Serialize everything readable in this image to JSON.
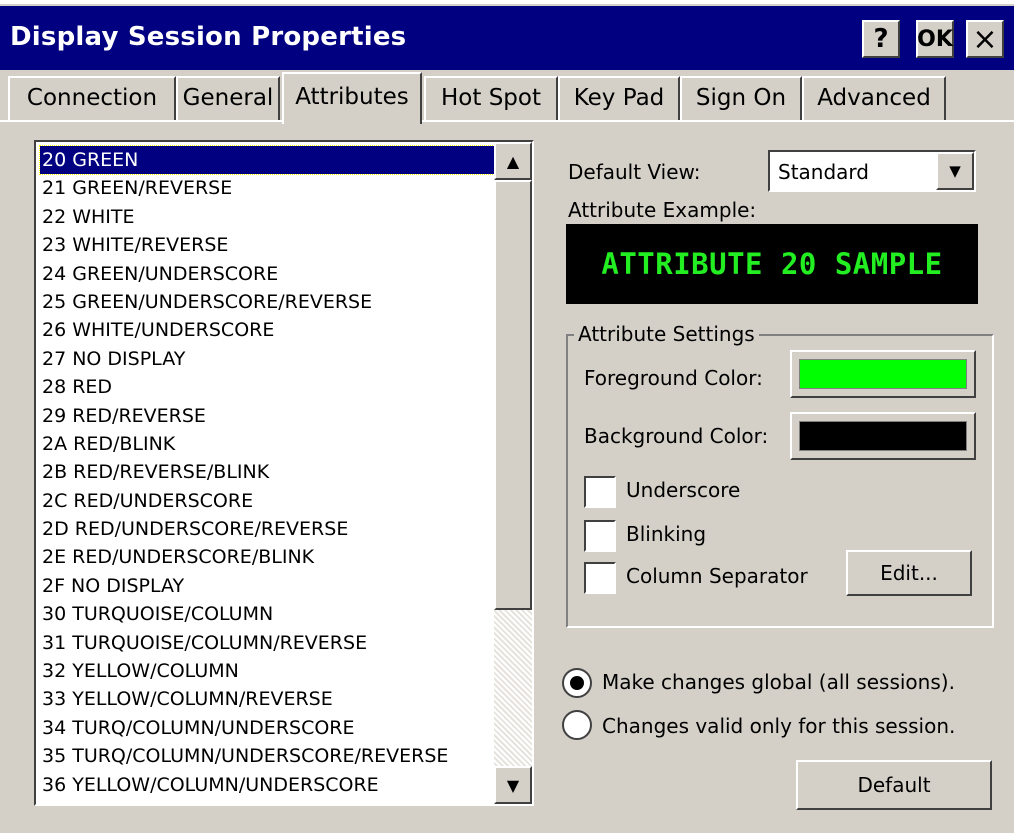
{
  "window": {
    "title": "Display Session Properties",
    "help_label": "?",
    "ok_label": "OK",
    "close_label": "×"
  },
  "tabs": [
    {
      "label": "Connection",
      "active": false
    },
    {
      "label": "General",
      "active": false
    },
    {
      "label": "Attributes",
      "active": true
    },
    {
      "label": "Hot Spot",
      "active": false
    },
    {
      "label": "Key Pad",
      "active": false
    },
    {
      "label": "Sign On",
      "active": false
    },
    {
      "label": "Advanced",
      "active": false
    }
  ],
  "attribute_list": {
    "selected_index": 0,
    "items": [
      "20 GREEN",
      "21 GREEN/REVERSE",
      "22 WHITE",
      "23 WHITE/REVERSE",
      "24 GREEN/UNDERSCORE",
      "25 GREEN/UNDERSCORE/REVERSE",
      "26 WHITE/UNDERSCORE",
      "27 NO DISPLAY",
      "28 RED",
      "29 RED/REVERSE",
      "2A RED/BLINK",
      "2B RED/REVERSE/BLINK",
      "2C RED/UNDERSCORE",
      "2D RED/UNDERSCORE/REVERSE",
      "2E RED/UNDERSCORE/BLINK",
      "2F NO DISPLAY",
      "30 TURQUOISE/COLUMN",
      "31 TURQUOISE/COLUMN/REVERSE",
      "32 YELLOW/COLUMN",
      "33 YELLOW/COLUMN/REVERSE",
      "34 TURQ/COLUMN/UNDERSCORE",
      "35 TURQ/COLUMN/UNDERSCORE/REVERSE",
      "36 YELLOW/COLUMN/UNDERSCORE"
    ],
    "scroll_up_icon": "triangle-up",
    "scroll_down_icon": "triangle-down"
  },
  "default_view": {
    "label": "Default View:",
    "value": "Standard",
    "dropdown_icon": "triangle-down"
  },
  "attribute_example": {
    "label": "Attribute Example:",
    "sample_text": "ATTRIBUTE 20 SAMPLE",
    "sample_color": "#22ee22",
    "background": "#000000"
  },
  "attribute_settings": {
    "legend": "Attribute Settings",
    "foreground_label": "Foreground Color:",
    "foreground_color": "#00ff00",
    "background_label": "Background Color:",
    "background_color": "#000000",
    "underscore_label": "Underscore",
    "underscore_checked": false,
    "blinking_label": "Blinking",
    "blinking_checked": false,
    "column_separator_label": "Column Separator",
    "column_separator_checked": false,
    "edit_label": "Edit..."
  },
  "scope": {
    "global_label": "Make changes global (all sessions).",
    "global_selected": true,
    "session_label": "Changes valid only for this session.",
    "session_selected": false
  },
  "default_button_label": "Default",
  "colors": {
    "face": "#d4d0c8",
    "titlebar": "#000080",
    "selection": "#000080"
  }
}
